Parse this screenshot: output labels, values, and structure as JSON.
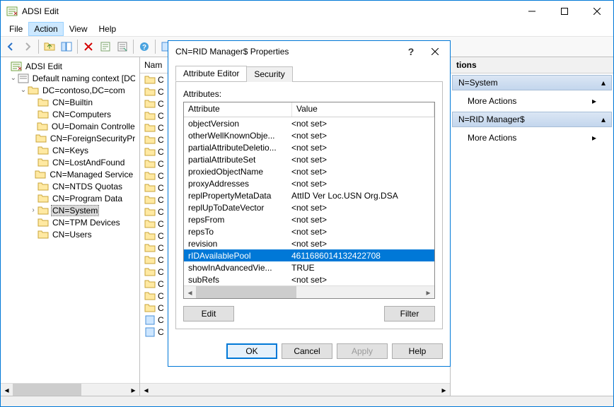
{
  "window": {
    "title": "ADSI Edit",
    "menu": [
      "File",
      "Action",
      "View",
      "Help"
    ],
    "menu_active_index": 1
  },
  "tree": {
    "root": "ADSI Edit",
    "ctx": "Default naming context [DC",
    "dc": "DC=contoso,DC=com",
    "nodes": [
      "CN=Builtin",
      "CN=Computers",
      "OU=Domain Controllers",
      "CN=ForeignSecurityPrincipals",
      "CN=Keys",
      "CN=LostAndFound",
      "CN=Managed Service Accounts",
      "CN=NTDS Quotas",
      "CN=Program Data",
      "CN=System",
      "CN=TPM Devices",
      "CN=Users"
    ],
    "selected_index": 9,
    "expandable_index": 9
  },
  "list": {
    "header": "Nam",
    "cell_prefix": "C"
  },
  "actions": {
    "header": "tions",
    "group1": "N=System",
    "group2": "N=RID Manager$",
    "more": "More Actions"
  },
  "dialog": {
    "title": "CN=RID Manager$ Properties",
    "tabs": [
      "Attribute Editor",
      "Security"
    ],
    "active_tab": 0,
    "attributes_label": "Attributes:",
    "col1": "Attribute",
    "col2": "Value",
    "rows": [
      {
        "a": "objectVersion",
        "v": "<not set>"
      },
      {
        "a": "otherWellKnownObje...",
        "v": "<not set>"
      },
      {
        "a": "partialAttributeDeletio...",
        "v": "<not set>"
      },
      {
        "a": "partialAttributeSet",
        "v": "<not set>"
      },
      {
        "a": "proxiedObjectName",
        "v": "<not set>"
      },
      {
        "a": "proxyAddresses",
        "v": "<not set>"
      },
      {
        "a": "replPropertyMetaData",
        "v": "AttID  Ver    Loc.USN              Org.DSA"
      },
      {
        "a": "replUpToDateVector",
        "v": "<not set>"
      },
      {
        "a": "repsFrom",
        "v": "<not set>"
      },
      {
        "a": "repsTo",
        "v": "<not set>"
      },
      {
        "a": "revision",
        "v": "<not set>"
      },
      {
        "a": "rIDAvailablePool",
        "v": "4611686014132422708"
      },
      {
        "a": "showInAdvancedVie...",
        "v": "TRUE"
      },
      {
        "a": "subRefs",
        "v": "<not set>"
      }
    ],
    "selected_row": 11,
    "buttons": {
      "edit": "Edit",
      "filter": "Filter",
      "ok": "OK",
      "cancel": "Cancel",
      "apply": "Apply",
      "help": "Help"
    }
  }
}
